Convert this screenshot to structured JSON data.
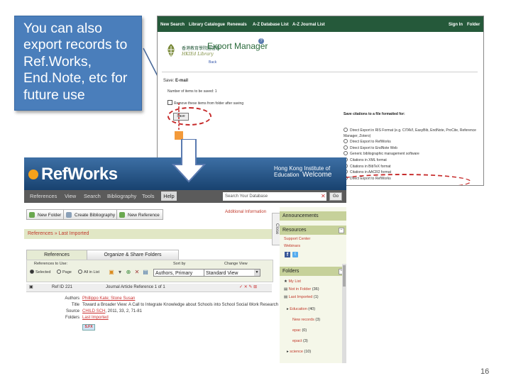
{
  "callout": {
    "lines": [
      "You can also",
      "export records to",
      "Ref.Works,",
      "End.Note, etc for",
      "future use"
    ],
    "bg_color": "#4a7ebb"
  },
  "export_manager": {
    "nav": [
      "New Search",
      "Library Catalogue",
      "Renewals",
      "A-Z Database List",
      "A-Z Journal List",
      "Sign In",
      "Folder"
    ],
    "library_name_cn": "香港教育學院圖書館",
    "library_name_en": "HKIEd Library",
    "title": "Export Manager",
    "help": "?",
    "back": "Back",
    "save_label": "Save:",
    "save_value": "E-mail",
    "number_saved": "Number of items to be saved: 1",
    "remove_option": "Remove these items from folder after saving",
    "save_button": "Save",
    "right_heading": "Save citations to a file formatted for:",
    "options": [
      "Direct Export in RIS Format (e.g. CITAVI, EasyBib, EndNote, ProCite, Reference Manager, Zotero)",
      "Direct Export to RefWorks",
      "Direct Export to EndNote Web",
      "Generic bibliographic management software",
      "Citations in XML format",
      "Citations in BibTeX format",
      "Citations in AACR2 format",
      "Direct Export to RefWorks"
    ]
  },
  "refworks": {
    "logo": "RefWorks",
    "institution": "Hong Kong Institute of Education",
    "welcome": "Welcome",
    "menu": [
      "References",
      "View",
      "Search",
      "Bibliography",
      "Tools",
      "Help"
    ],
    "search_placeholder": "Search Your Database",
    "search_go": "Go",
    "buttons": [
      "New Folder",
      "Create Bibliography",
      "New Reference"
    ],
    "additional_info": "Additional Information",
    "breadcrumb": [
      "References",
      "Last Imported"
    ],
    "close_tab": "Close",
    "tabs": [
      "References",
      "Organize & Share Folders"
    ],
    "references_to_use": "References to Use:",
    "radio_options": [
      "Selected",
      "Page",
      "All in List"
    ],
    "sort_by_label": "Sort by",
    "sort_by_value": "Authors, Primary",
    "change_view_label": "Change View",
    "change_view_value": "Standard View",
    "ref_id_label": "Ref ID",
    "ref_id": "221",
    "ref_count": "Journal Article Reference 1 of 1",
    "fields": {
      "authors_label": "Authors",
      "authors": "Phillippo Kate; Stone Susan",
      "title_label": "Title",
      "title": "Toward a Broader View: A Call to Integrate Knowledge about Schools into School Social Work Research",
      "source_label": "Source",
      "source_link": "CHILD SCH",
      "source_rest": ", 2011, 33, 2, 71-81",
      "folders_label": "Folders",
      "folders": "Last Imported",
      "sfx": "S.FX"
    },
    "rail": {
      "announcements": "Announcements",
      "resources": "Resources",
      "support": "Support Center",
      "webinars": "Webinars",
      "folders": "Folders",
      "folder_items": [
        {
          "name": "My List",
          "count": ""
        },
        {
          "name": "Not in Folder",
          "count": "(36)"
        },
        {
          "name": "Last Imported",
          "count": "(1)"
        },
        {
          "name": "Education",
          "count": "(40)"
        },
        {
          "name": "New records",
          "count": "(3)"
        },
        {
          "name": "epac",
          "count": "(0)"
        },
        {
          "name": "epact",
          "count": "(3)"
        },
        {
          "name": "science",
          "count": "(10)"
        }
      ]
    }
  },
  "page_number": "16"
}
